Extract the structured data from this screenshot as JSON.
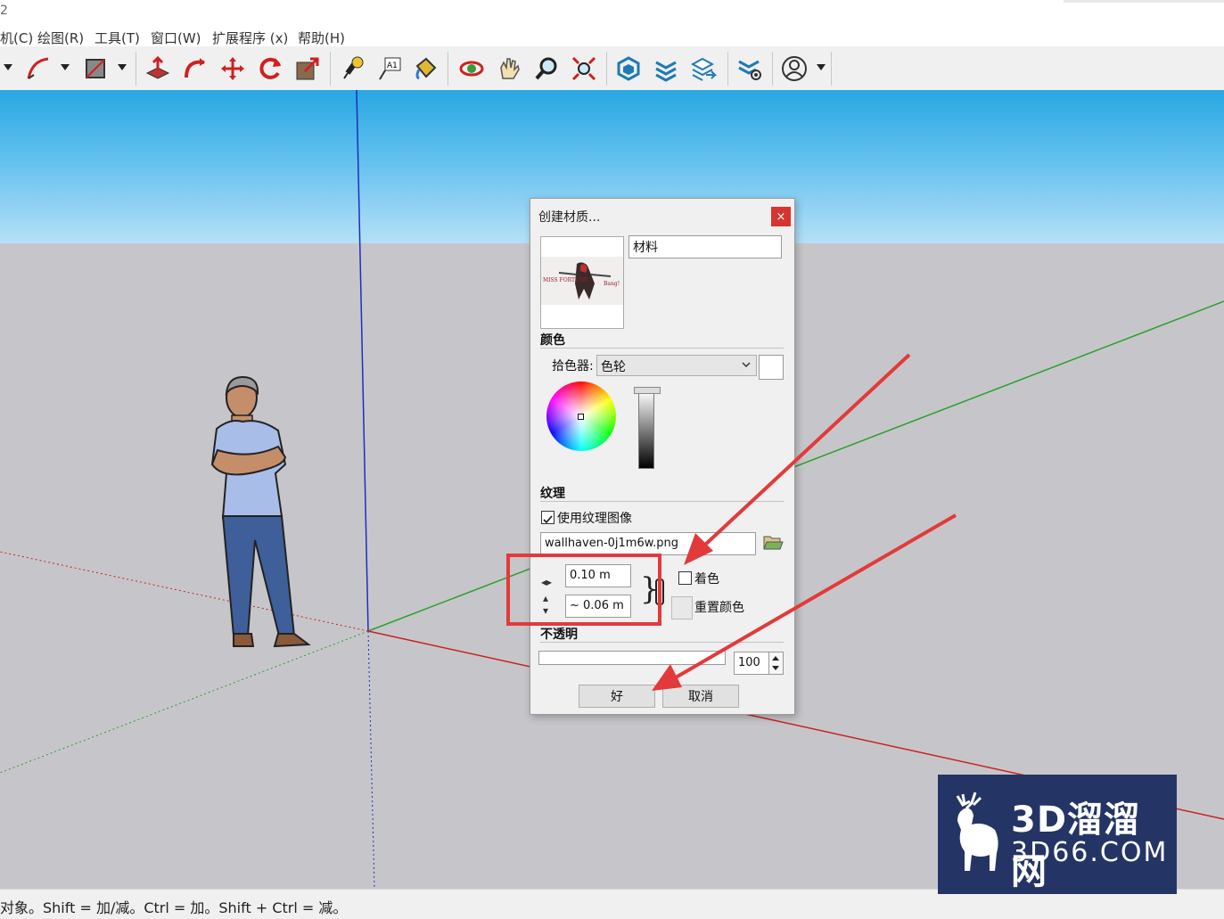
{
  "window": {
    "title_fragment": "2"
  },
  "menu": [
    "机(C)",
    "绘图(R)",
    "工具(T)",
    "窗口(W)",
    "扩展程序 (x)",
    "帮助(H)"
  ],
  "toolbar": {
    "icons": [
      "arc-icon",
      "shape-icon",
      "push-pull-icon",
      "follow-me-icon",
      "move-icon",
      "rotate-icon",
      "scale-icon",
      "tape-measure-icon",
      "text-label-icon",
      "paint-bucket-icon",
      "orbit-icon",
      "pan-icon",
      "zoom-icon",
      "zoom-extents-icon",
      "warehouse-icon",
      "extension-warehouse-icon",
      "layout-icon",
      "extension-manager-icon",
      "account-icon"
    ],
    "text_tool_glyph": "A1"
  },
  "dialog": {
    "title": "创建材质...",
    "close": "×",
    "material_name": "材料",
    "thumbnail_caption": "MISS FORTUNE",
    "thumbnail_caption2": "Bang!",
    "color_section": "颜色",
    "picker_label": "拾色器:",
    "picker_value": "色轮",
    "texture_section": "纹理",
    "use_texture_label": "使用纹理图像",
    "use_texture_checked": true,
    "file_name": "wallhaven-0j1m6w.png",
    "width_value": "0.10 m",
    "height_value": "~ 0.06 m",
    "colorize_label": "着色",
    "colorize_checked": false,
    "reset_color_label": "重置颜色",
    "opacity_section": "不透明",
    "opacity_value": "100",
    "ok_label": "好",
    "cancel_label": "取消"
  },
  "statusbar": {
    "text": "对象。Shift = 加/减。Ctrl = 加。Shift + Ctrl = 减。"
  },
  "watermark": {
    "title": "3D溜溜网",
    "url": "3D66.COM"
  },
  "colors": {
    "sky_top": "#28a7e2",
    "ground": "#c6c6ca",
    "annotation_red": "#e23a3a",
    "watermark_bg": "#243565"
  }
}
